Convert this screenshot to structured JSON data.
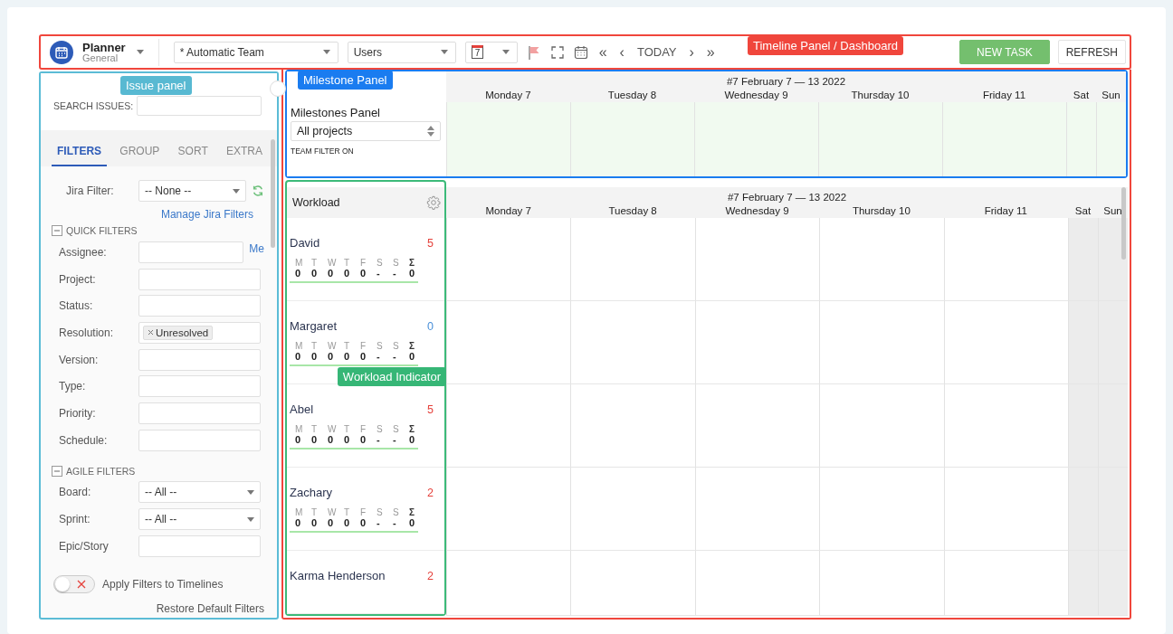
{
  "toolbar": {
    "app_title": "Planner",
    "app_subtitle": "General",
    "team_select": "* Automatic Team",
    "view_select": "Users",
    "date_icon_day": "7",
    "nav": [
      {
        "label": "«"
      },
      {
        "label": "‹"
      },
      {
        "label": "TODAY"
      },
      {
        "label": "›"
      },
      {
        "label": "»"
      }
    ],
    "buttons": [
      {
        "label": "NEW TASK",
        "kind": "primary"
      },
      {
        "label": "REFRESH",
        "kind": "default"
      }
    ]
  },
  "timeline_annotation": "Timeline Panel / Dashboard",
  "issue_panel": {
    "annotation": "Issue panel",
    "search_label": "SEARCH ISSUES:",
    "tabs": [
      {
        "label": "FILTERS",
        "selected": true
      },
      {
        "label": "GROUP",
        "selected": false
      },
      {
        "label": "SORT",
        "selected": false
      },
      {
        "label": "EXTRA",
        "selected": false
      }
    ],
    "jira_filter": {
      "label": "Jira Filter:",
      "value": "-- None --"
    },
    "manage_link": "Manage Jira Filters",
    "sections": [
      {
        "title": "QUICK FILTERS",
        "expanded": true,
        "fields": [
          {
            "label": "Assignee:",
            "kind": "text",
            "link": "Me"
          },
          {
            "label": "Project:",
            "kind": "text"
          },
          {
            "label": "Status:",
            "kind": "text"
          },
          {
            "label": "Resolution:",
            "kind": "tags",
            "tags": [
              "Unresolved"
            ]
          },
          {
            "label": "Version:",
            "kind": "text"
          },
          {
            "label": "Type:",
            "kind": "text"
          },
          {
            "label": "Priority:",
            "kind": "text"
          },
          {
            "label": "Schedule:",
            "kind": "text"
          }
        ]
      },
      {
        "title": "AGILE FILTERS",
        "expanded": true,
        "fields": [
          {
            "label": "Board:",
            "kind": "select",
            "value": "-- All --"
          },
          {
            "label": "Sprint:",
            "kind": "select",
            "value": "-- All --"
          },
          {
            "label": "Epic/Story",
            "kind": "text"
          }
        ]
      }
    ],
    "apply_toggle": {
      "label": "Apply Filters to Timelines",
      "on": false
    },
    "restore_link": "Restore Default Filters"
  },
  "milestone_panel": {
    "annotation": "Milestone Panel",
    "title": "Milestones Panel",
    "project_select": "All projects",
    "team_filter": "TEAM FILTER ON",
    "week_title": "#7 February 7 — 13 2022",
    "days": [
      {
        "label": "Monday 7",
        "weekend": false
      },
      {
        "label": "Tuesday 8",
        "weekend": false
      },
      {
        "label": "Wednesday 9",
        "weekend": false
      },
      {
        "label": "Thursday 10",
        "weekend": false
      },
      {
        "label": "Friday 11",
        "weekend": false
      },
      {
        "label": "Sat",
        "weekend": true
      },
      {
        "label": "Sun",
        "weekend": true
      }
    ]
  },
  "workload_panel": {
    "annotation": "Workload Indicator",
    "title": "Workload",
    "week_title": "#7 February 7 — 13 2022",
    "days": [
      {
        "label": "Monday 7",
        "weekend": false
      },
      {
        "label": "Tuesday 8",
        "weekend": false
      },
      {
        "label": "Wednesday 9",
        "weekend": false
      },
      {
        "label": "Thursday 10",
        "weekend": false
      },
      {
        "label": "Friday 11",
        "weekend": false
      },
      {
        "label": "Sat",
        "weekend": true
      },
      {
        "label": "Sun",
        "weekend": true
      }
    ],
    "members": [
      {
        "name": "David",
        "count": "5",
        "color": "#e5413b",
        "day_letters": [
          "M",
          "T",
          "W",
          "T",
          "F",
          "S",
          "S",
          "Σ"
        ],
        "day_values": [
          "0",
          "0",
          "0",
          "0",
          "0",
          "-",
          "-",
          "0"
        ]
      },
      {
        "name": "Margaret",
        "count": "0",
        "color": "#4a90d9",
        "day_letters": [
          "M",
          "T",
          "W",
          "T",
          "F",
          "S",
          "S",
          "Σ"
        ],
        "day_values": [
          "0",
          "0",
          "0",
          "0",
          "0",
          "-",
          "-",
          "0"
        ]
      },
      {
        "name": "Abel",
        "count": "5",
        "color": "#e5413b",
        "day_letters": [
          "M",
          "T",
          "W",
          "T",
          "F",
          "S",
          "S",
          "Σ"
        ],
        "day_values": [
          "0",
          "0",
          "0",
          "0",
          "0",
          "-",
          "-",
          "0"
        ]
      },
      {
        "name": "Zachary",
        "count": "2",
        "color": "#e5413b",
        "day_letters": [
          "M",
          "T",
          "W",
          "T",
          "F",
          "S",
          "S",
          "Σ"
        ],
        "day_values": [
          "0",
          "0",
          "0",
          "0",
          "0",
          "-",
          "-",
          "0"
        ]
      },
      {
        "name": "Karma Henderson",
        "count": "2",
        "color": "#e5413b"
      }
    ]
  }
}
